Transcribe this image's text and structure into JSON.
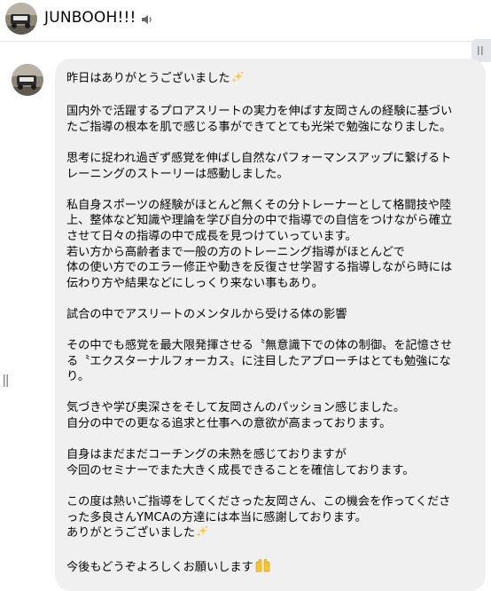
{
  "header": {
    "name": "JUNBOOH!!!"
  },
  "message": {
    "paragraphs": [
      {
        "lines": [
          "昨日はありがとうございました"
        ],
        "trailing_emoji": "sparkles-icon"
      },
      {
        "lines": [
          "国内外で活躍するプロアスリートの実力を伸ばす友岡さんの経験に基づい",
          "たご指導の根本を肌で感じる事ができてとても光栄で勉強になりました。"
        ]
      },
      {
        "lines": [
          "思考に捉われ過ぎず感覚を伸ばし自然なパフォーマンスアップに繋げるト",
          "レーニングのストーリーは感動しました。"
        ]
      },
      {
        "lines": [
          "私自身スポーツの経験がほとんど無くその分トレーナーとして格闘技や陸",
          "上、整体など知識や理論を学び自分の中で指導での自信をつけながら確立",
          "させて日々の指導の中で成長を見つけていっています。",
          "若い方から高齢者まで一般の方のトレーニング指導がほとんどで",
          "体の使い方でのエラー修正や動きを反復させ学習する指導しながら時には",
          "伝わり方や結果などにしっくり来ない事もあり。"
        ]
      },
      {
        "lines": [
          "試合の中でアスリートのメンタルから受ける体の影響"
        ]
      },
      {
        "lines": [
          "その中でも感覚を最大限発揮させる〝無意識下での体の制御〟を記憶させ",
          "る〝エクスターナルフォーカス〟に注目したアプローチはとても勉強にな",
          "り。"
        ]
      },
      {
        "lines": [
          "気づきや学び奥深さをそして友岡さんのパッション感じました。",
          "自分の中での更なる追求と仕事への意欲が高まっております。"
        ]
      },
      {
        "lines": [
          "自身はまだまだコーチングの未熟を感じておりますが",
          "今回のセミナーでまた大きく成長できることを確信しております。"
        ]
      },
      {
        "lines": [
          "この度は熱いご指導をしてくださった友岡さん、この機会を作ってくださ",
          "った多良さんYMCAの方達には本当に感謝しております。",
          "ありがとうございました"
        ],
        "trailing_emoji": "sparkles-icon"
      },
      {
        "lines": [
          "今後もどうぞよろしくお願いします"
        ],
        "trailing_emoji": "raised-hands-icon"
      }
    ]
  },
  "icons": {
    "speaker": "speaker-icon",
    "corner": "chevron-icon",
    "handle": "resize-handle-icon"
  }
}
